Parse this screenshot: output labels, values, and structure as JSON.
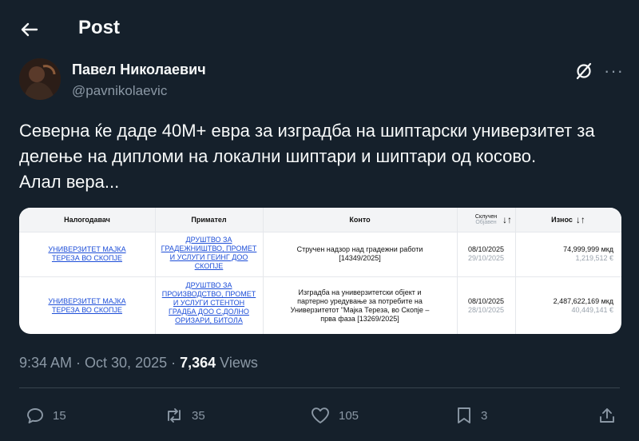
{
  "header": {
    "title": "Post"
  },
  "author": {
    "name": "Павел Николаевич",
    "handle": "@pavnikolaevic"
  },
  "post": {
    "lines": [
      "Северна ќе даде 40М+ евра за изградба на шиптарски универзитет за",
      "делење на дипломи на локални шиптари и шиптари од косово.",
      "Алал вера..."
    ]
  },
  "table": {
    "headers": {
      "issuer": "Налогодавач",
      "recipient": "Примател",
      "account": "Конто",
      "date_top": "Склучен",
      "date_bottom": "Објавен",
      "amount": "Износ"
    },
    "rows": [
      {
        "issuer": [
          "УНИВЕРЗИТЕТ МАЈКА",
          "ТЕРЕЗА ВО СКОПЈЕ"
        ],
        "recipient": [
          "ДРУШТВО ЗА",
          "ГРАДЕЖНИШТВО, ПРОМЕТ",
          "И УСЛУГИ ГЕИНГ ДОО",
          "СКОПЈЕ"
        ],
        "account": [
          "Стручен надзор над градежни работи",
          "[14349/2025]"
        ],
        "date1": "08/10/2025",
        "date2": "29/10/2025",
        "amount_mkd": "74,999,999 мкд",
        "amount_eur": "1,219,512 €"
      },
      {
        "issuer": [
          "УНИВЕРЗИТЕТ МАЈКА",
          "ТЕРЕЗА ВО СКОПЈЕ"
        ],
        "recipient": [
          "ДРУШТВО ЗА",
          "ПРОИЗВОДСТВО, ПРОМЕТ",
          "И УСЛУГИ СТЕНТОН",
          "ГРАДБА ДОО С.ДОЛНО",
          "ОРИЗАРИ, БИТОЛА"
        ],
        "account": [
          "Изградба на универзитетски објект и",
          "партерно уредување за потребите на",
          "Универзитетот \"Мајка Тереза, во Скопје –",
          "прва фаза [13269/2025]"
        ],
        "date1": "08/10/2025",
        "date2": "28/10/2025",
        "amount_mkd": "2,487,622,169 мкд",
        "amount_eur": "40,449,141 €"
      }
    ]
  },
  "meta": {
    "time": "9:34 AM · Oct 30, 2025 · ",
    "views_count": "7,364",
    "views_label": " Views"
  },
  "actions": {
    "replies": "15",
    "reposts": "35",
    "likes": "105",
    "bookmarks": "3"
  },
  "colors": {
    "background": "#15202b",
    "text": "#f7f9f9",
    "muted": "#8b98a5",
    "link": "#1d4ed8"
  }
}
